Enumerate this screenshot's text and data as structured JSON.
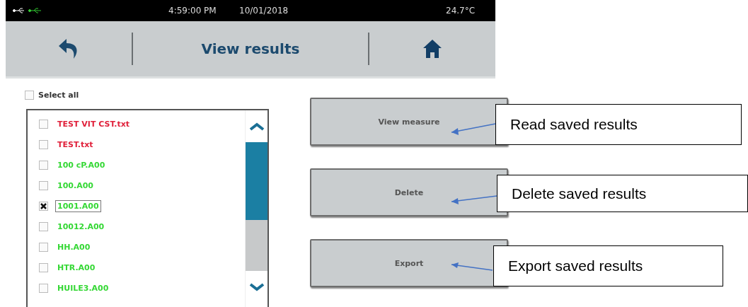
{
  "status_bar": {
    "time": "4:59:00 PM",
    "date": "10/01/2018",
    "temperature": "24.7°C"
  },
  "header": {
    "title": "View results"
  },
  "select_all": {
    "label": "Select all",
    "checked": false
  },
  "files": [
    {
      "name": "TEST VIT CST.txt",
      "color": "#e0203a",
      "checked": false,
      "focused": false
    },
    {
      "name": "TEST.txt",
      "color": "#e0203a",
      "checked": false,
      "focused": false
    },
    {
      "name": "100 cP.A00",
      "color": "#35d835",
      "checked": false,
      "focused": false
    },
    {
      "name": "100.A00",
      "color": "#35d835",
      "checked": false,
      "focused": false
    },
    {
      "name": "1001.A00",
      "color": "#35d835",
      "checked": true,
      "focused": true
    },
    {
      "name": "10012.A00",
      "color": "#35d835",
      "checked": false,
      "focused": false
    },
    {
      "name": "HH.A00",
      "color": "#35d835",
      "checked": false,
      "focused": false
    },
    {
      "name": "HTR.A00",
      "color": "#35d835",
      "checked": false,
      "focused": false
    },
    {
      "name": "HUILE3.A00",
      "color": "#35d835",
      "checked": false,
      "focused": false
    }
  ],
  "actions": [
    "View measure",
    "Delete",
    "Export"
  ],
  "callouts": [
    {
      "text": "Read saved results"
    },
    {
      "text": "Delete saved results"
    },
    {
      "text": "Export saved results"
    }
  ]
}
